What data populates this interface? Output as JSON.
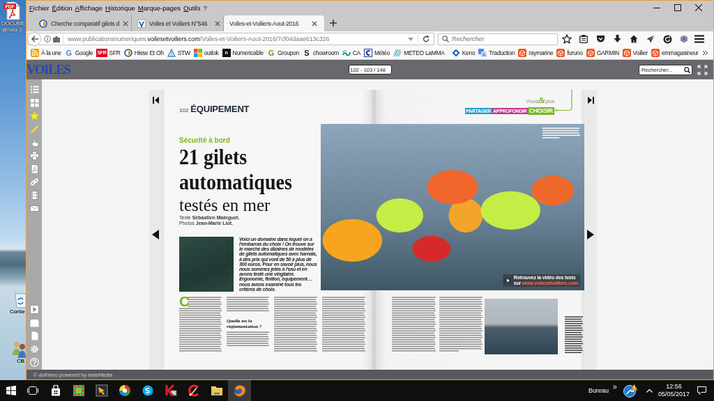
{
  "desktop": {
    "icons": [
      {
        "kind": "pdf",
        "badge": "PDF",
        "label": [
          "DOCUME",
          "gib'sea 3"
        ]
      },
      {
        "kind": "recycle-bin",
        "label": [
          "Corbe"
        ]
      },
      {
        "kind": "people",
        "label": [
          "CB"
        ]
      }
    ]
  },
  "browser": {
    "menu": [
      "Fichier",
      "Édition",
      "Affichage",
      "Historique",
      "Marque-pages",
      "Outils",
      "?"
    ],
    "tabs": [
      {
        "title": "Cherche comparatif gilets d",
        "kind": "forum",
        "selected": false
      },
      {
        "title": "Voiles et Voiliers N°546",
        "kind": "v-tile",
        "selected": false
      },
      {
        "title": "Voiles-et-Voiliers-Aout-2016",
        "kind": "none",
        "selected": true
      }
    ],
    "url": "www.publicationsnumeriques.**voilesetvoiliers.com**/Voiles-et-Voiliers-Aout-2016/7cf04daae613c326",
    "search": {
      "placeholder": "Rechercher"
    },
    "bookmark_groups": [
      [
        {
          "label": "À la une",
          "kind": "rss"
        },
        {
          "label": "Google",
          "kind": "letter",
          "glyph": "G",
          "color": "#4285f4"
        },
        {
          "label": "SFR",
          "kind": "tile",
          "glyph": "SFR",
          "color": "#e2001a"
        },
        {
          "label": "Hisse Et Oh",
          "kind": "swirl"
        },
        {
          "label": "STW",
          "kind": "triangle"
        },
        {
          "label": "outlok",
          "kind": "squares"
        },
        {
          "label": "Numericable",
          "kind": "tile",
          "glyph": "n",
          "color": "#111111"
        },
        {
          "label": "Groupon",
          "kind": "letter",
          "glyph": "G",
          "color": "#53a318"
        },
        {
          "label": "chowroom",
          "kind": "letter",
          "glyph": "S",
          "color": "#222222"
        },
        {
          "label": "CA",
          "kind": "wave"
        },
        {
          "label": "Météo",
          "kind": "bracket"
        },
        {
          "label": "METEO LaMMA",
          "kind": "stripes"
        }
      ],
      [
        {
          "label": "Keno",
          "kind": "diamond"
        },
        {
          "label": "Traduction",
          "kind": "translate"
        },
        {
          "label": "raymarine",
          "kind": "cube"
        },
        {
          "label": "furuno",
          "kind": "cube"
        },
        {
          "label": "GARMIN",
          "kind": "cube"
        },
        {
          "label": "Voilier",
          "kind": "cube"
        },
        {
          "label": "emmagasineur",
          "kind": "cube"
        }
      ]
    ]
  },
  "viewer": {
    "logo": "VOILES",
    "page_indicator": "102 - 103 / 148",
    "search": {
      "placeholder": "Rechercher..."
    },
    "footer": "© doKineo powered by anteMedia"
  },
  "magazine": {
    "left_page": {
      "page_number": "102",
      "section": "ÉQUIPEMENT",
      "kicker": "Sécurité à bord",
      "title_lines": [
        "21 gilets",
        "automatiques"
      ],
      "subtitle": "testés en mer",
      "credits": [
        "Texte **Sébastien Mainguet.**",
        "Photos **Jean-Marie Liot.**"
      ],
      "intro": "Voici un domaine dans lequel on a l'embarras du choix ! On trouve sur le marché des dizaines de modèles de gilets automatiques avec harnais, à des prix qui vont de 50 à plus de 300 euros. Pour en savoir plus, nous nous sommes jetés à l'eau et en avons testé une vingtaine. Ergonomie, finition, équipement… nous avons examiné tous les critères de choix.",
      "drop_cap": "C",
      "subheading": "Quelle est la réglementation ?"
    },
    "right_page": {
      "logo": [
        "Vous",
        "&",
        "plus"
      ],
      "tags": [
        {
          "label": "PARTAGER",
          "color": "#1ba1d6",
          "selected": false
        },
        {
          "label": "APPROFONDIR",
          "color": "#c2378c",
          "selected": false
        },
        {
          "label": "CHOISIR",
          "color": "#79b428",
          "selected": true
        }
      ],
      "video_link": [
        "Retrouvez la vidéo des tests",
        "sur **www.voilesetvoiliers.com**"
      ]
    }
  },
  "taskbar": {
    "apps": [
      {
        "kind": "mosaic",
        "selected": false
      },
      {
        "kind": "framed-arrow",
        "selected": false
      },
      {
        "kind": "pinwheel",
        "selected": false
      },
      {
        "kind": "bubble",
        "selected": false
      },
      {
        "kind": "k-window",
        "selected": false
      },
      {
        "kind": "arc-brush",
        "selected": false
      },
      {
        "kind": "folder",
        "selected": false
      },
      {
        "kind": "globe",
        "selected": true
      }
    ],
    "tray": {
      "label": "Bureau",
      "time": "12:56",
      "date": "05/05/2017"
    }
  }
}
